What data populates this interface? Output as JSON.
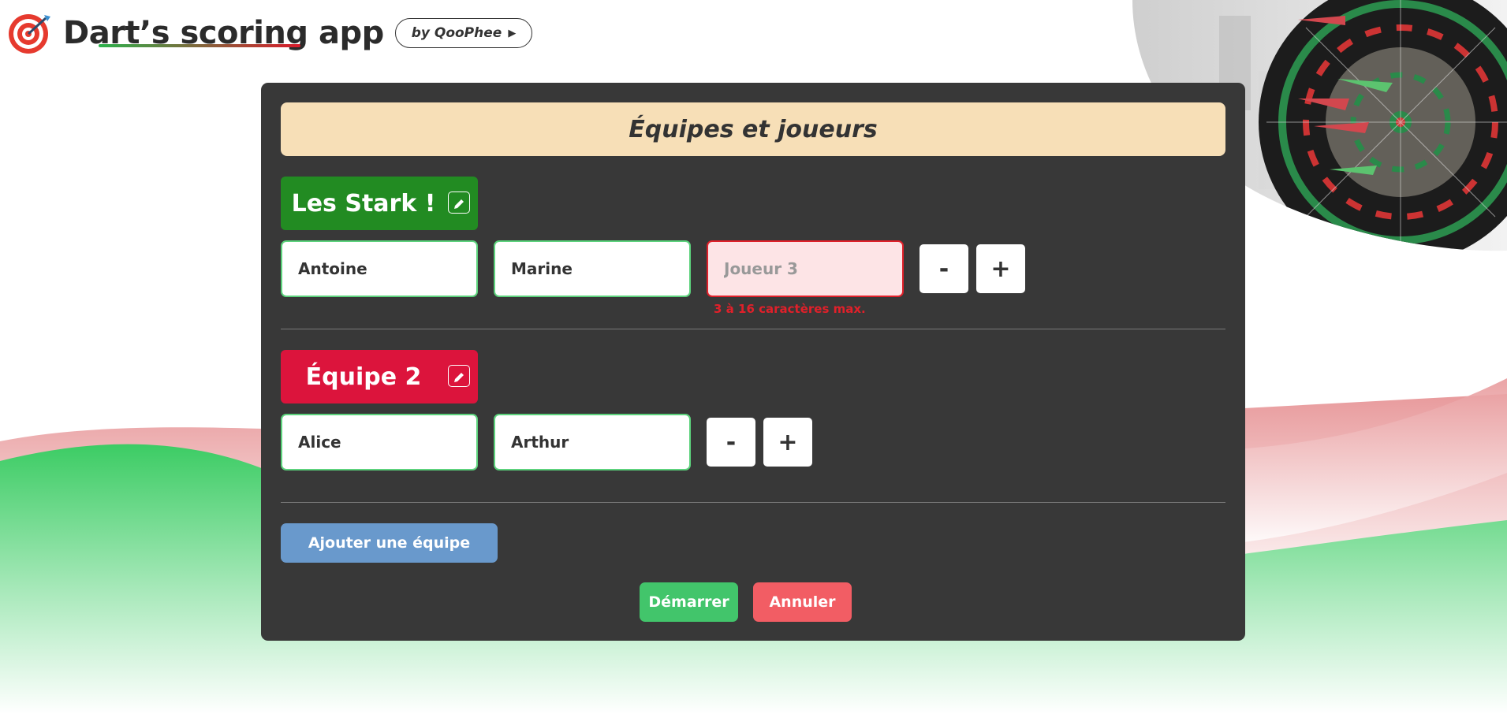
{
  "header": {
    "title": "Dart’s scoring app",
    "byline": "by QooPhee",
    "byline_arrow": "▶",
    "logo_icon": "dartboard-icon"
  },
  "panel": {
    "title": "Équipes et joueurs",
    "teams": [
      {
        "name": "Les Stark !",
        "color": "#228b22",
        "players": [
          {
            "value": "Antoine",
            "placeholder": ""
          },
          {
            "value": "Marine",
            "placeholder": ""
          },
          {
            "value": "",
            "placeholder": "Joueur 3",
            "error": "3 à 16 caractères max."
          }
        ]
      },
      {
        "name": "Équipe 2",
        "color": "#dc143c",
        "players": [
          {
            "value": "Alice",
            "placeholder": ""
          },
          {
            "value": "Arthur",
            "placeholder": ""
          }
        ]
      }
    ],
    "minus_label": "-",
    "plus_label": "+",
    "add_team_label": "Ajouter une équipe",
    "start_label": "Démarrer",
    "cancel_label": "Annuler"
  },
  "colors": {
    "panel_bg": "#383838",
    "title_bg": "#f7dfb7",
    "start": "#42c56b",
    "cancel": "#f25d64",
    "add_team": "#6999cc",
    "input_border_ok": "#5cd27c",
    "input_border_error": "#e0202a"
  }
}
